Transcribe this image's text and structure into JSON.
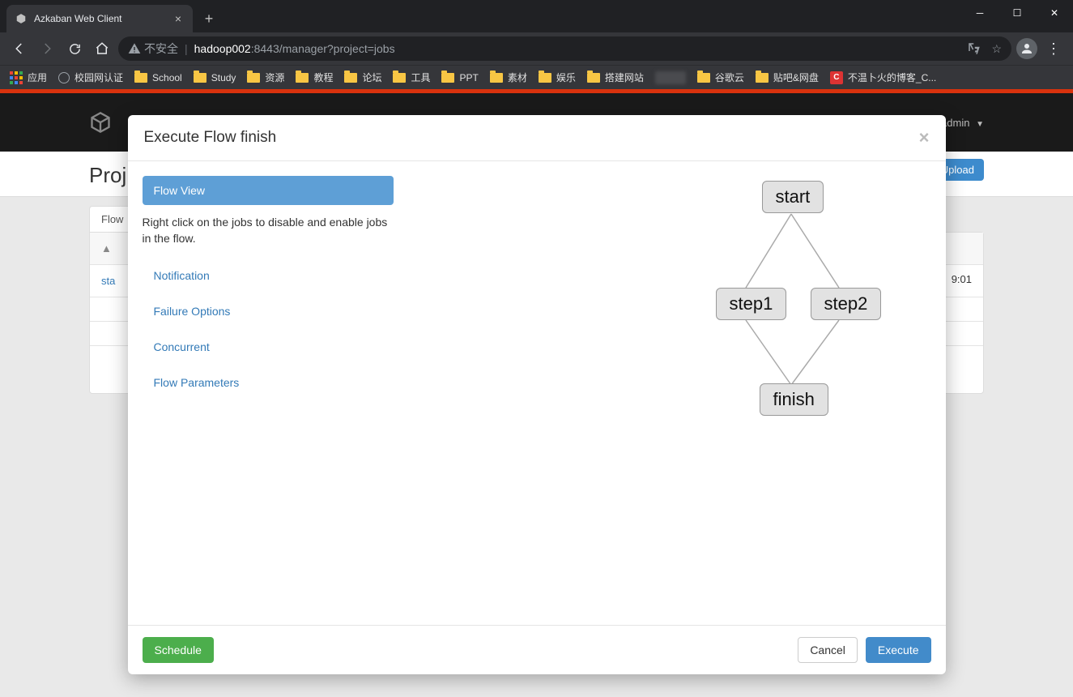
{
  "browser": {
    "tab_title": "Azkaban Web Client",
    "url_warning": "不安全",
    "url_host": "hadoop002",
    "url_port_path": ":8443/manager?project=jobs",
    "bookmarks": {
      "apps": "应用",
      "items": [
        "校园网认证",
        "School",
        "Study",
        "资源",
        "教程",
        "论坛",
        "工具",
        "PPT",
        "素材",
        "娱乐",
        "搭建网站",
        "",
        "谷歌云",
        "贴吧&网盘",
        "不温卜火的博客_C..."
      ]
    }
  },
  "app": {
    "admin_label": "admin",
    "upload_label": "Upload",
    "page_title_prefix": "Proj",
    "flow_tab_label": "Flow",
    "row_link_prefix": "sta",
    "right_time": "9:01"
  },
  "modal": {
    "title": "Execute Flow finish",
    "close": "×",
    "side": {
      "active": "Flow View",
      "hint": "Right click on the jobs to disable and enable jobs in the flow.",
      "items": [
        "Notification",
        "Failure Options",
        "Concurrent",
        "Flow Parameters"
      ]
    },
    "nodes": {
      "start": "start",
      "step1": "step1",
      "step2": "step2",
      "finish": "finish"
    },
    "footer": {
      "schedule": "Schedule",
      "cancel": "Cancel",
      "execute": "Execute"
    }
  }
}
